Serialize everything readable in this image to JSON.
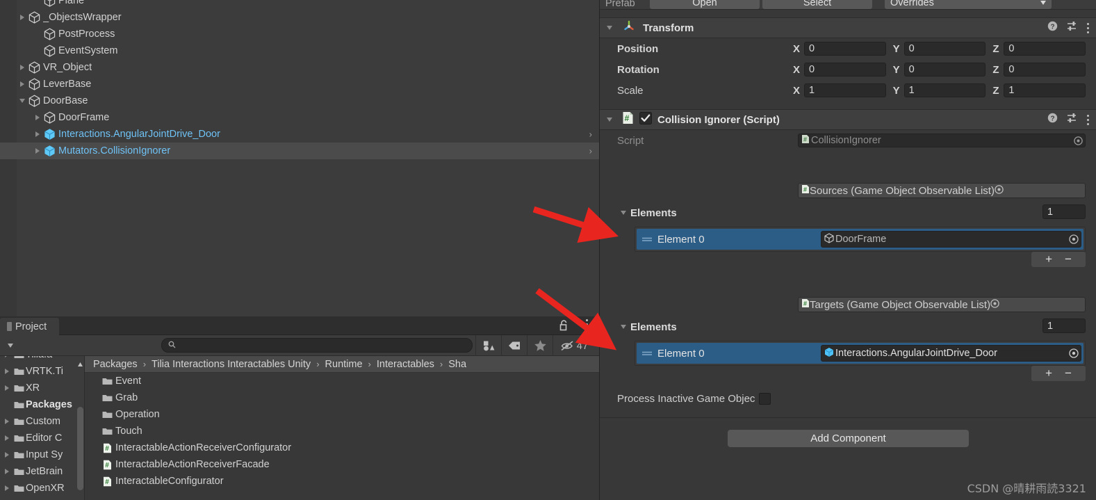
{
  "hierarchy": {
    "rows": [
      {
        "label": "Plane",
        "depth": 2,
        "fold": "none",
        "prefab": false,
        "selected": false,
        "clipped": true,
        "chevron": false
      },
      {
        "label": "_ObjectsWrapper",
        "depth": 1,
        "fold": "right",
        "prefab": false,
        "selected": false,
        "clipped": false,
        "chevron": false
      },
      {
        "label": "PostProcess",
        "depth": 2,
        "fold": "none",
        "prefab": false,
        "selected": false,
        "clipped": false,
        "chevron": false
      },
      {
        "label": "EventSystem",
        "depth": 2,
        "fold": "none",
        "prefab": false,
        "selected": false,
        "clipped": false,
        "chevron": false
      },
      {
        "label": "VR_Object",
        "depth": 1,
        "fold": "right",
        "prefab": false,
        "selected": false,
        "clipped": false,
        "chevron": false
      },
      {
        "label": "LeverBase",
        "depth": 1,
        "fold": "right",
        "prefab": false,
        "selected": false,
        "clipped": false,
        "chevron": false
      },
      {
        "label": "DoorBase",
        "depth": 1,
        "fold": "down",
        "prefab": false,
        "selected": false,
        "clipped": false,
        "chevron": false
      },
      {
        "label": "DoorFrame",
        "depth": 2,
        "fold": "right",
        "prefab": false,
        "selected": false,
        "clipped": false,
        "chevron": false
      },
      {
        "label": "Interactions.AngularJointDrive_Door",
        "depth": 2,
        "fold": "right",
        "prefab": true,
        "selected": false,
        "clipped": false,
        "chevron": true
      },
      {
        "label": "Mutators.CollisionIgnorer",
        "depth": 2,
        "fold": "right",
        "prefab": true,
        "selected": true,
        "clipped": false,
        "chevron": true
      }
    ]
  },
  "project": {
    "tab_label": "Project",
    "search": {
      "value": "",
      "placeholder": ""
    },
    "toolbar": {
      "filter_type_icon": "type-filter-icon",
      "filter_label_icon": "label-filter-icon",
      "favorite_icon": "star-icon",
      "hidden_count_icon": "eye-slash-icon",
      "hidden_count": "47",
      "lock_icon": "lock-open-icon",
      "kebab_icon": "kebab-menu-icon",
      "dropdown_icon": "chevron-down-icon"
    },
    "tree": [
      {
        "label": "Tilia.a",
        "arrow": true,
        "bold": false,
        "clipped": true
      },
      {
        "label": "VRTK.Ti",
        "arrow": true,
        "bold": false,
        "clipped": false
      },
      {
        "label": "XR",
        "arrow": true,
        "bold": false,
        "clipped": false
      },
      {
        "label": "Packages",
        "arrow": false,
        "bold": true,
        "clipped": false
      },
      {
        "label": "Custom",
        "arrow": true,
        "bold": false,
        "clipped": false
      },
      {
        "label": "Editor C",
        "arrow": true,
        "bold": false,
        "clipped": false
      },
      {
        "label": "Input Sy",
        "arrow": true,
        "bold": false,
        "clipped": false
      },
      {
        "label": "JetBrain",
        "arrow": true,
        "bold": false,
        "clipped": false
      },
      {
        "label": "OpenXR",
        "arrow": true,
        "bold": false,
        "clipped": false
      }
    ],
    "breadcrumb": [
      "Packages",
      "Tilia Interactions Interactables Unity",
      "Runtime",
      "Interactables",
      "Sha"
    ],
    "files": [
      {
        "name": "Event",
        "kind": "folder"
      },
      {
        "name": "Grab",
        "kind": "folder"
      },
      {
        "name": "Operation",
        "kind": "folder"
      },
      {
        "name": "Touch",
        "kind": "folder"
      },
      {
        "name": "InteractableActionReceiverConfigurator",
        "kind": "script"
      },
      {
        "name": "InteractableActionReceiverFacade",
        "kind": "script"
      },
      {
        "name": "InteractableConfigurator",
        "kind": "script"
      }
    ]
  },
  "inspector": {
    "prefab": {
      "label": "Prefab",
      "open_label": "Open",
      "select_label": "Select",
      "overrides_label": "Overrides",
      "overrides_icon": "chevron-down-icon"
    },
    "transform": {
      "title": "Transform",
      "icon": "transform-gizmo-icon",
      "help_icon": "help-icon",
      "preset_icon": "preset-settings-icon",
      "menu_icon": "kebab-menu-icon",
      "rows": [
        {
          "label": "Position",
          "x": "0",
          "y": "0",
          "z": "0",
          "bold": true
        },
        {
          "label": "Rotation",
          "x": "0",
          "y": "0",
          "z": "0",
          "bold": true
        },
        {
          "label": "Scale",
          "x": "1",
          "y": "1",
          "z": "1",
          "bold": false
        }
      ],
      "axis_labels": [
        "X",
        "Y",
        "Z"
      ]
    },
    "collision_ignorer": {
      "title": "Collision Ignorer (Script)",
      "icon": "cs-script-icon",
      "enabled": true,
      "help_icon": "help-icon",
      "preset_icon": "preset-settings-icon",
      "menu_icon": "kebab-menu-icon",
      "script_row": {
        "label": "Script",
        "value": "CollisionIgnorer",
        "picker_icon": "object-picker-icon"
      },
      "sources": {
        "header": "Sources (Game Object Observable List)",
        "picker_icon": "object-picker-icon",
        "elements_label": "Elements",
        "count": "1",
        "elements": [
          {
            "label": "Element 0",
            "value": "DoorFrame",
            "value_icon": "gameobject-icon",
            "picker_icon": "object-picker-icon",
            "selected": true
          }
        ],
        "add_label": "+",
        "remove_label": "−"
      },
      "targets": {
        "header": "Targets (Game Object Observable List)",
        "picker_icon": "object-picker-icon",
        "elements_label": "Elements",
        "count": "1",
        "elements": [
          {
            "label": "Element 0",
            "value": "Interactions.AngularJointDrive_Door",
            "value_icon": "prefab-icon",
            "picker_icon": "object-picker-icon",
            "selected": true
          }
        ],
        "add_label": "+",
        "remove_label": "−"
      },
      "process_inactive": {
        "label": "Process Inactive Game Objec",
        "checked": false
      }
    },
    "add_component_label": "Add Component"
  },
  "annotations": {
    "arrow_color": "#e8251f",
    "arrow_count": 2
  },
  "watermark": "CSDN @晴耕雨読3321",
  "colors": {
    "panel_bg": "#383838",
    "hierarchy_bg": "#3c3c3c",
    "selection_blue": "#2c5d87",
    "prefab_blue": "#6fc2f5",
    "breadcrumb_bg": "#4a4a4a",
    "button_bg": "#585858"
  }
}
